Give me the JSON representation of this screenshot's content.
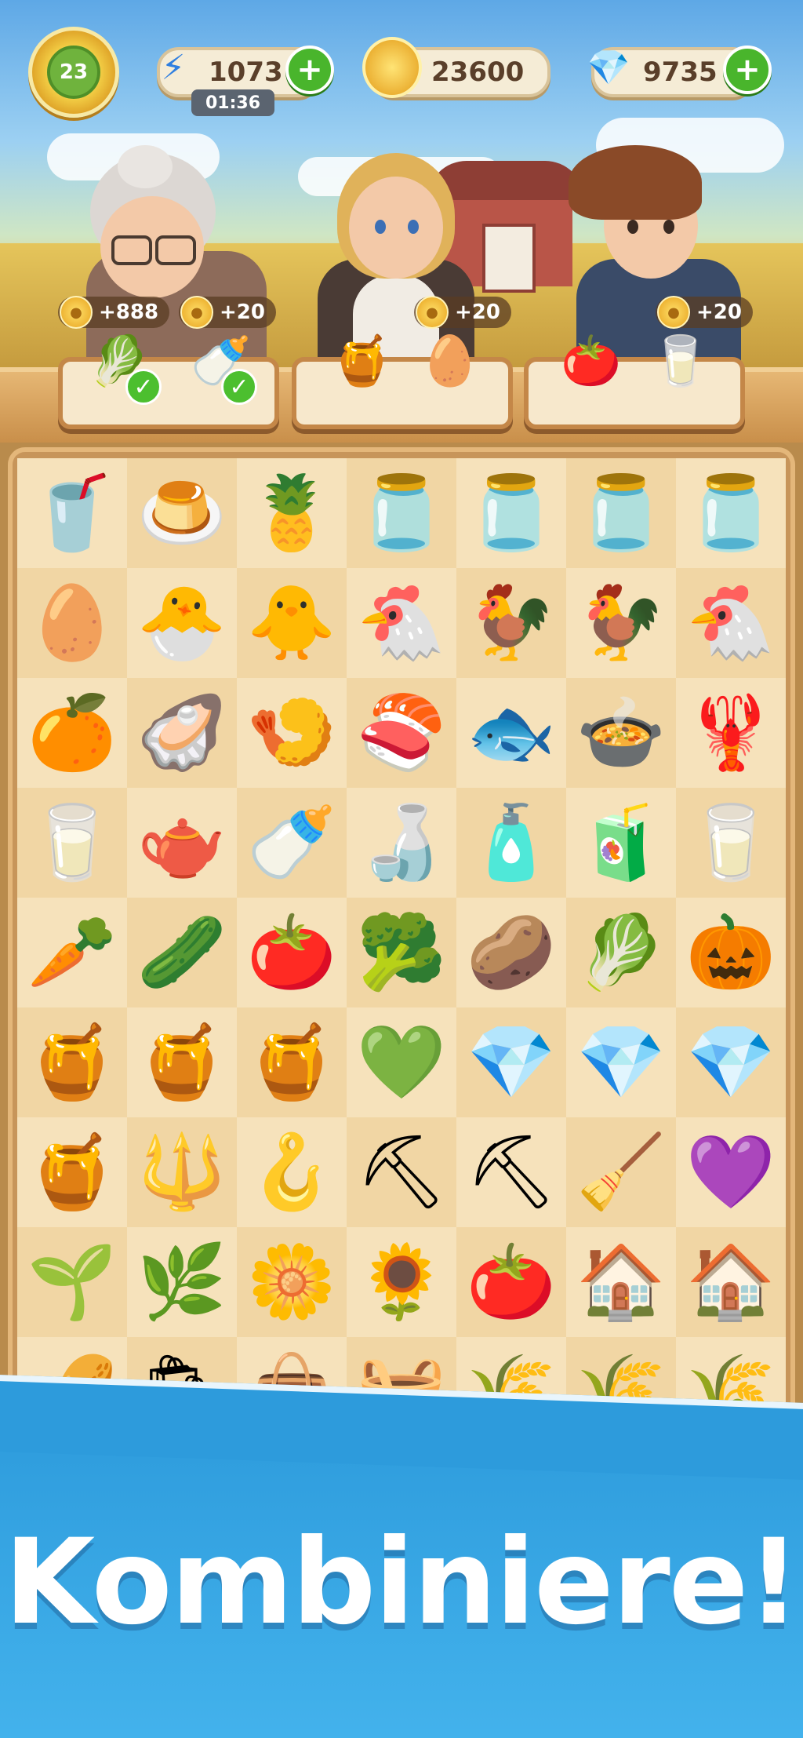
{
  "hud": {
    "level": "23",
    "energy": "1073",
    "energy_timer": "01:36",
    "coins": "23600",
    "gems": "9735",
    "plus_label": "+"
  },
  "orders": [
    {
      "reward": "+888",
      "items": [
        {
          "icon": "cabbage-icon",
          "glyph": "🥬",
          "done": true
        }
      ]
    },
    {
      "reward": "+20",
      "items": [
        {
          "icon": "milk-bottle-icon",
          "glyph": "🍼",
          "done": true
        }
      ]
    },
    {
      "reward": "+20",
      "items": [
        {
          "icon": "honey-jar-icon",
          "glyph": "🍯",
          "done": false
        },
        {
          "icon": "egg-icon",
          "glyph": "🥚",
          "done": false
        }
      ]
    },
    {
      "reward": "+20",
      "items": [
        {
          "icon": "tomato-icon",
          "glyph": "🍅",
          "done": false
        },
        {
          "icon": "milk-carton-icon",
          "glyph": "🥛",
          "done": false
        }
      ]
    }
  ],
  "board": [
    [
      "🥤",
      "🍮",
      "🍍",
      "🫙",
      "🫙",
      "🫙",
      "🫙"
    ],
    [
      "🥚",
      "🐣",
      "🐥",
      "🐔",
      "🐓",
      "🐓",
      "🐔"
    ],
    [
      "🍊",
      "🦪",
      "🍤",
      "🍣",
      "🐟",
      "🍲",
      "🦞"
    ],
    [
      "🥛",
      "🫖",
      "🍼",
      "🍶",
      "🧴",
      "🧃",
      "🥛"
    ],
    [
      "🥕",
      "🥒",
      "🍅",
      "🥦",
      "🥔",
      "🥬",
      "🎃"
    ],
    [
      "🍯",
      "🍯",
      "🍯",
      "💚",
      "💎",
      "💎",
      "💎"
    ],
    [
      "🍯",
      "🔱",
      "🪝",
      "⛏",
      "⛏",
      "🧹",
      "💜"
    ],
    [
      "🌱",
      "🌿",
      "🌼",
      "🌻",
      "🍅",
      "🏠",
      "🏠"
    ],
    [
      "🥜",
      "🛍",
      "👜",
      "🧺",
      "🌾",
      "🌾",
      "🌾"
    ]
  ],
  "board_names": [
    [
      "juice-glass-icon",
      "pudding-bowl-icon",
      "pineapple-bowl-icon",
      "jam-jar-icon",
      "jam-jar-tied-icon",
      "jam-jar-covered-icon",
      "jam-jar-ribbon-icon"
    ],
    [
      "egg-icon",
      "hatching-chick-icon",
      "chick-icon",
      "hen-icon",
      "rooster-icon",
      "brown-hen-icon",
      "white-hen-icon"
    ],
    [
      "roe-bowl-icon",
      "oyster-icon",
      "shrimp-plate-icon",
      "salmon-plate-icon",
      "fish-plate-icon",
      "seafood-stew-icon",
      "lobster-plate-icon"
    ],
    [
      "milk-glass-icon",
      "milk-jug-icon",
      "milk-bottle-icon",
      "milk-flask-icon",
      "milk-jar-icon",
      "milk-carton-icon",
      "cow-milk-carton-icon"
    ],
    [
      "carrot-icon",
      "cucumber-icon",
      "tomato-icon",
      "broccoli-icon",
      "potato-icon",
      "cabbage-icon",
      "pumpkin-icon"
    ],
    [
      "honeycomb-icon",
      "honey-bowl-icon",
      "honey-jar-icon",
      "green-crystal-icon",
      "teal-crystal-icon",
      "blue-crystal-icon",
      "red-crystal-icon"
    ],
    [
      "honey-pot-icon",
      "hand-fork-icon",
      "sickle-icon",
      "hoe-icon",
      "shovel-icon",
      "rake-icon",
      "purple-crystal-icon"
    ],
    [
      "sprout-icon",
      "seedling-icon",
      "flowering-plant-icon",
      "tomato-flower-plant-icon",
      "tomato-plant-icon",
      "small-greenhouse-icon",
      "greenhouse-icon"
    ],
    [
      "pistachio-icon",
      "seed-bag-icon",
      "nut-sack-icon",
      "produce-basket-icon",
      "wheat-bundle-icon",
      "hay-roll-icon",
      "hay-bale-icon"
    ]
  ],
  "slogan": "Kombiniere!",
  "colors": {
    "banner": "#2d9bdc",
    "board": "#c7955a",
    "plus": "#49b52c"
  }
}
